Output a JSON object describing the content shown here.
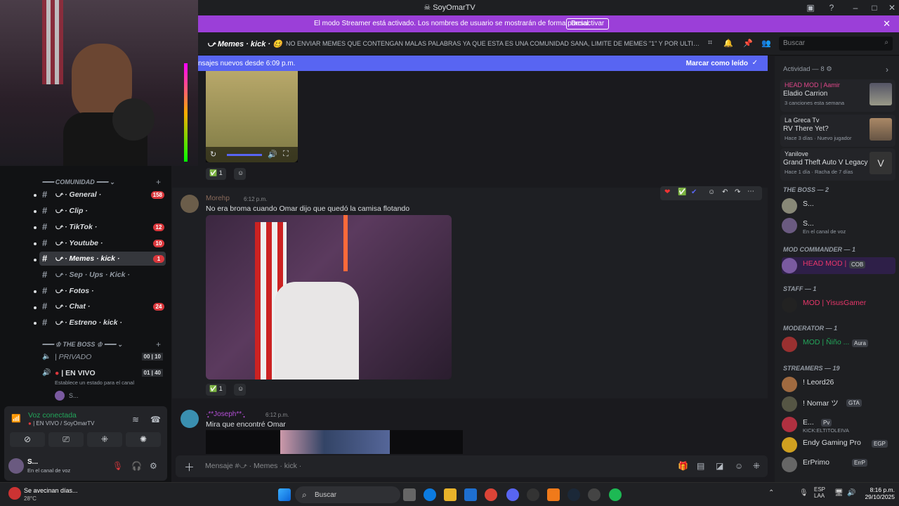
{
  "window": {
    "title": "SoyOmarTV"
  },
  "banner": {
    "message": "El modo Streamer está activado. Los nombres de usuario se mostrarán de forma parcial.",
    "button": "Desactivar"
  },
  "header": {
    "channel": "Memes · kick ·",
    "topic": "NO ENVIAR MEMES QUE CONTENGAN MALAS PALABRAS YA QUE ESTA ES UNA COMUNIDAD SANA, LIMITE DE MEMES \"1\" Y POR ULTIMO EL ...",
    "search_placeholder": "Buscar"
  },
  "newbar": {
    "left": "nsajes nuevos desde 6:09 p.m.",
    "right": "Marcar como leído"
  },
  "sidebar": {
    "category1": "COMUNIDAD",
    "channels": [
      {
        "label": "⤻ · General ·",
        "badge": "158"
      },
      {
        "label": "⤻ · Clip ·",
        "badge": ""
      },
      {
        "label": "⤻ · TikTok ·",
        "badge": "12"
      },
      {
        "label": "⤻ · Youtube ·",
        "badge": "10"
      },
      {
        "label": "⤻ · Memes · kick ·",
        "badge": "1"
      },
      {
        "label": "⤻ · Sep · Ups · Kick ·",
        "badge": ""
      },
      {
        "label": "⤻ · Fotos ·",
        "badge": ""
      },
      {
        "label": "⤻ · Chat ·",
        "badge": "24"
      },
      {
        "label": "⤻ · Estreno · kick ·",
        "badge": ""
      }
    ],
    "category2": "THE BOSS",
    "voice_channels": [
      {
        "label": "| PRIVADO",
        "count": "00",
        "limit": "10"
      },
      {
        "label": "| EN VIVO",
        "count": "01",
        "limit": "40"
      }
    ],
    "status_hint": "Establece un estado para el canal",
    "voice_user": "S..."
  },
  "voice": {
    "title": "Voz conectada",
    "subtitle": "| EN VIVO / SoyOmarTV"
  },
  "user": {
    "name": "S...",
    "status": "En el canal de voz"
  },
  "messages": [
    {
      "author": "Morehp",
      "time": "6:12 p.m.",
      "text": "No era broma cuando Omar dijo que quedó la camisa flotando",
      "reaction_count": "1"
    },
    {
      "author": "·̩̩̥͙**Joseph**·̩̩̥͙",
      "time": "6:12 p.m.",
      "text": "Mira que encontré Omar"
    }
  ],
  "first_reaction_count": "1",
  "composer": {
    "placeholder": "Mensaje #⤻ · Memes · kick ·"
  },
  "members": {
    "activity_title": "Actividad — 8",
    "activities": [
      {
        "user": "HEAD MOD | Aamir",
        "title": "Eladio Carrion",
        "meta": "3 canciones esta semana"
      },
      {
        "user": "La Greca Tv",
        "title": "RV There Yet?",
        "meta": "Hace 3 días  ·  Nuevo jugador"
      },
      {
        "user": "Yanilove",
        "title": "Grand Theft Auto V Legacy",
        "meta": "Hace 1 día  ·  Racha de 7 días"
      }
    ],
    "groups": [
      {
        "role": "THE BOSS — 2",
        "members": [
          {
            "name": "S...",
            "status": ""
          },
          {
            "name": "S...",
            "status": "En el canal de voz"
          }
        ]
      },
      {
        "role": "MOD COMMANDER — 1",
        "members": [
          {
            "name": "HEAD MOD |",
            "status": "",
            "tag": "COB"
          }
        ]
      },
      {
        "role": "STAFF — 1",
        "members": [
          {
            "name": "MOD | YisusGamer",
            "status": ""
          }
        ]
      },
      {
        "role": "MODERATOR — 1",
        "members": [
          {
            "name": "MOD | Ñiño ...",
            "status": "",
            "tag": "Aura"
          }
        ]
      },
      {
        "role": "STREAMERS — 19",
        "members": [
          {
            "name": "! Leord26",
            "status": ""
          },
          {
            "name": "! Nomar ツ",
            "status": "",
            "tag": "GTA"
          },
          {
            "name": "E...",
            "status": "KICK:ELTITOLEIVA",
            "tag": "Pv"
          },
          {
            "name": "Endy Gaming Pro",
            "status": "",
            "tag": "EGP"
          },
          {
            "name": "ErPrimo",
            "status": "",
            "tag": "ErrP"
          }
        ]
      }
    ]
  },
  "taskbar": {
    "weather_title": "Se avecinan días...",
    "weather_temp": "28°C",
    "search": "Buscar",
    "lang1": "ESP",
    "lang2": "LAA",
    "time": "8:16 p.m.",
    "date": "29/10/2025"
  },
  "colors": {
    "accent": "#5865f2",
    "streamer": "#9b3fd8",
    "mention": "#da373c"
  }
}
